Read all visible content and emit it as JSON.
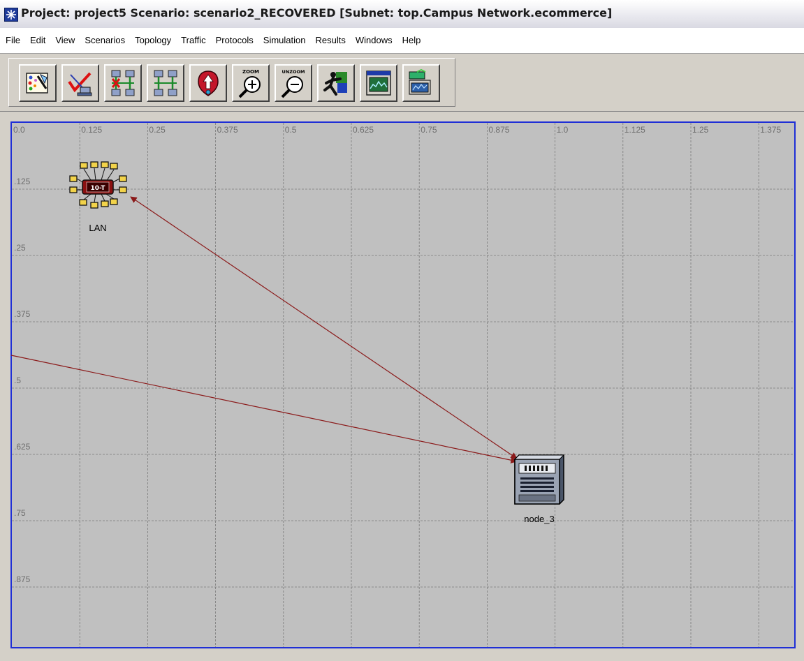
{
  "window": {
    "title": "Project: project5 Scenario: scenario2_RECOVERED  [Subnet: top.Campus Network.ecommerce]"
  },
  "menu": [
    "File",
    "Edit",
    "View",
    "Scenarios",
    "Topology",
    "Traffic",
    "Protocols",
    "Simulation",
    "Results",
    "Windows",
    "Help"
  ],
  "toolbar": {
    "buttons": [
      {
        "name": "open-object-palette-button",
        "icon": "palette-icon"
      },
      {
        "name": "check-link-consistency-button",
        "icon": "checkmark-link-icon"
      },
      {
        "name": "fail-link-button",
        "icon": "fail-link-icon"
      },
      {
        "name": "recover-link-button",
        "icon": "recover-link-icon"
      },
      {
        "name": "return-to-parent-subnet-button",
        "icon": "up-arrow-icon"
      },
      {
        "name": "zoom-button",
        "icon": "zoom-in-icon",
        "label": "ZOOM"
      },
      {
        "name": "unzoom-button",
        "icon": "zoom-out-icon",
        "label": "UNZOOM"
      },
      {
        "name": "configure-simulation-button",
        "icon": "runner-icon"
      },
      {
        "name": "view-simulation-results-button",
        "icon": "results-graph-icon"
      },
      {
        "name": "hide-show-graphs-button",
        "icon": "graph-panels-icon"
      }
    ]
  },
  "workspace": {
    "x_ticks": [
      "0.0",
      "0.125",
      "0.25",
      "0.375",
      "0.5",
      "0.625",
      "0.75",
      "0.875",
      "1.0",
      "1.125",
      "1.25",
      "1.375"
    ],
    "y_ticks": [
      ".125",
      ".25",
      ".375",
      ".5",
      ".625",
      ".75",
      ".875"
    ],
    "nodes": [
      {
        "id": "lan",
        "label": "LAN",
        "type": "lan-10base-t",
        "badge": "10-T"
      },
      {
        "id": "node_3",
        "label": "node_3",
        "type": "server"
      }
    ],
    "links": [
      {
        "from": "lan",
        "to": "node_3"
      },
      {
        "from": "offscreen-left",
        "to": "node_3"
      }
    ],
    "colors": {
      "grid_border": "#1f2fd6",
      "link": "#8b1a1a",
      "canvas": "#c0c0c0",
      "grid_line": "#7a7a7a"
    }
  }
}
